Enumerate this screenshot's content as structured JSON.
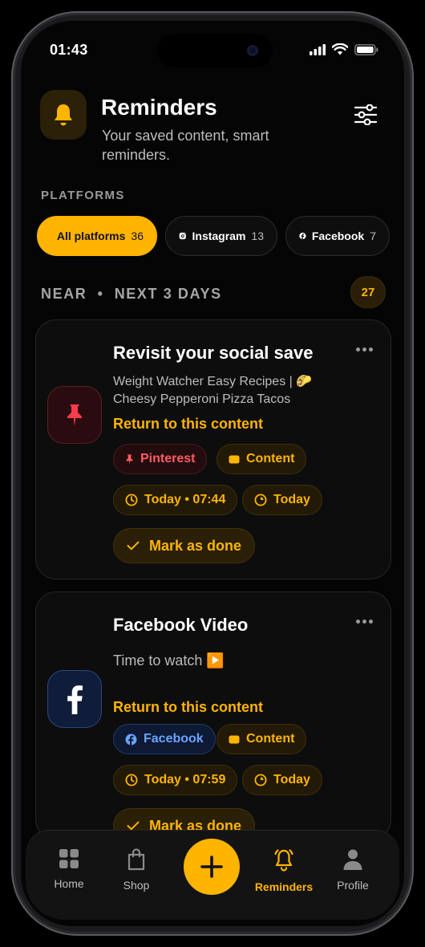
{
  "status": {
    "time": "01:43"
  },
  "header": {
    "title": "Reminders",
    "subtitle": "Your saved content, smart reminders."
  },
  "platforms": {
    "section_label": "PLATFORMS",
    "chips": [
      {
        "label": "All platforms",
        "count": "36",
        "icon": "sparkle-icon",
        "active": true
      },
      {
        "label": "Instagram",
        "count": "13",
        "icon": "instagram-icon",
        "active": false
      },
      {
        "label": "Facebook",
        "count": "7",
        "icon": "facebook-icon",
        "active": false
      }
    ]
  },
  "near": {
    "label": "NEAR  •  NEXT 3 DAYS",
    "count": "27"
  },
  "cards": [
    {
      "title": "Revisit your social save",
      "description": "Weight Watcher Easy Recipes | 🌮 Cheesy Pepperoni Pizza Tacos",
      "link": "Return to this content",
      "platform_tag": "Pinterest",
      "type_tag": "Content",
      "time_tag": "Today • 07:44",
      "day_tag": "Today",
      "done_label": "Mark as done",
      "icon": "pin-icon"
    },
    {
      "title": "Facebook Video",
      "description": "Time to watch ▶️",
      "link": "Return to this content",
      "platform_tag": "Facebook",
      "type_tag": "Content",
      "time_tag": "Today • 07:59",
      "day_tag": "Today",
      "done_label": "Mark as done",
      "icon": "facebook-icon"
    }
  ],
  "tabbar": {
    "items": [
      {
        "label": "Home",
        "icon": "grid-icon"
      },
      {
        "label": "Shop",
        "icon": "bag-icon"
      },
      {
        "label": "Reminders",
        "icon": "bell-icon",
        "active": true
      },
      {
        "label": "Profile",
        "icon": "person-icon"
      }
    ],
    "fab_icon": "plus-icon"
  },
  "colors": {
    "accent": "#ffb400",
    "background": "#050505",
    "pinterest": "#ff5a66",
    "facebook": "#6aa3ff"
  }
}
